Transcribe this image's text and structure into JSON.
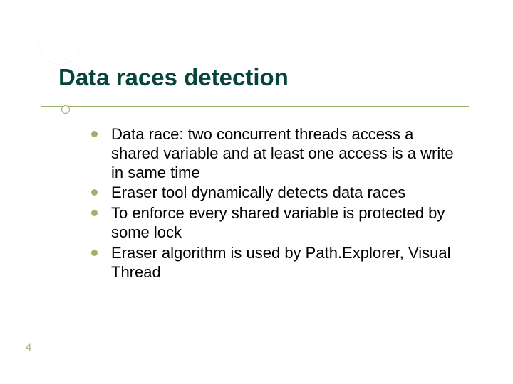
{
  "slide": {
    "title": "Data races detection",
    "page_number": "4",
    "bullets": [
      "Data race: two concurrent threads access a shared variable and at least one access is a write in same time",
      "Eraser tool dynamically detects data races",
      "To enforce every shared variable is protected by some lock",
      "Eraser algorithm is used by Path.Explorer, Visual Thread"
    ]
  }
}
